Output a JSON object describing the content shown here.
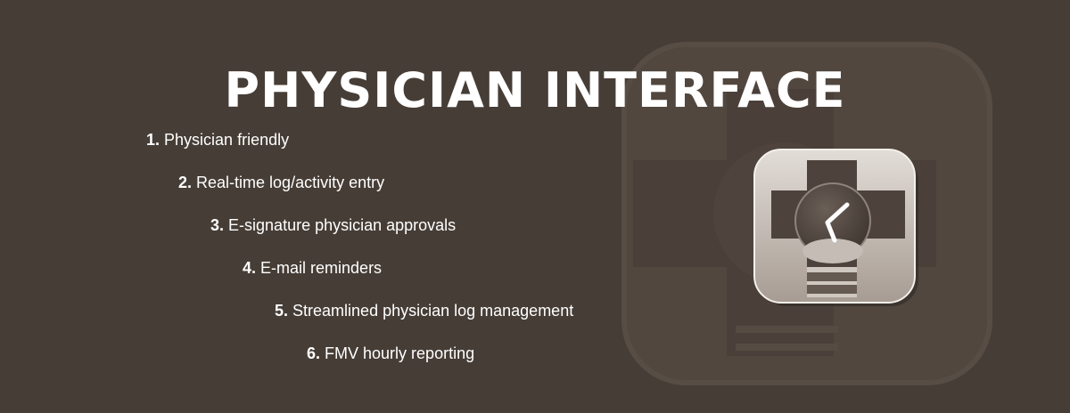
{
  "page": {
    "title": "PHYSICIAN INTERFACE",
    "background_color": "#463d36",
    "text_color": "#ffffff"
  },
  "features": [
    {
      "num": "1.",
      "text": "Physician friendly"
    },
    {
      "num": "2.",
      "text": "Real-time log/activity entry"
    },
    {
      "num": "3.",
      "text": "E-signature physician approvals"
    },
    {
      "num": "4.",
      "text": "E-mail reminders"
    },
    {
      "num": "5.",
      "text": "Streamlined physician log management"
    },
    {
      "num": "6.",
      "text": "FMV hourly reporting"
    }
  ],
  "icons": {
    "background": "medical-cross-clock-watermark-icon",
    "app": "medical-cross-clock-app-icon"
  }
}
